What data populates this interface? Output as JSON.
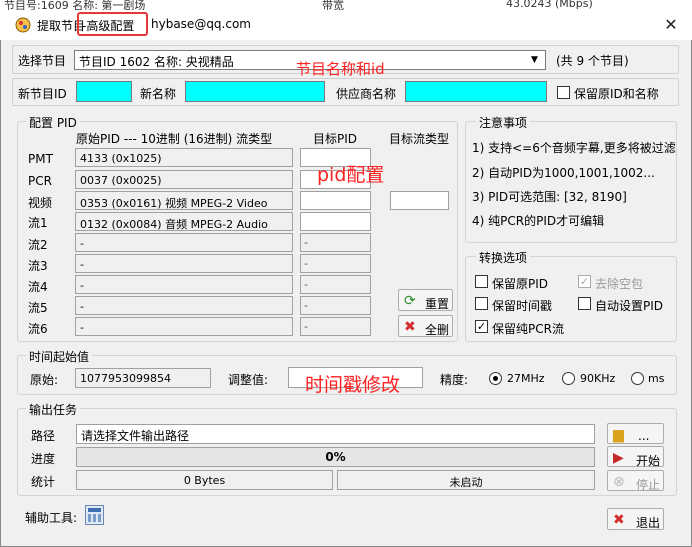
{
  "background_window": {
    "text_left": "节目号:1609  名称: 第一剧场",
    "text_mid": "带宽",
    "text_right": "43.0243  (Mbps)"
  },
  "dialog": {
    "title_prefix": "提取节目",
    "title_highlight": "-高级配置",
    "title_suffix": "hybase@qq.com",
    "close": "✕"
  },
  "program_select": {
    "label": "选择节目",
    "value": "节目ID 1602 名称: 央视精品",
    "count": "(共 9 个节目)",
    "annotation": "节目名称和id"
  },
  "new_program": {
    "id_label": "新节目ID",
    "name_label": "新名称",
    "provider_label": "供应商名称",
    "keep_label": "保留原ID和名称",
    "id_value": "",
    "name_value": "",
    "provider_value": ""
  },
  "pid_config": {
    "title": "配置 PID",
    "col_original": "原始PID --- 10进制 (16进制) 流类型",
    "col_target_pid": "目标PID",
    "col_target_type": "目标流类型",
    "annotation": "pid配置",
    "rows": [
      {
        "label": "PMT",
        "original": "4133 (0x1025)",
        "target": "",
        "editable": true,
        "has_type": false
      },
      {
        "label": "PCR",
        "original": "0037 (0x0025)",
        "target": "",
        "editable": true,
        "has_type": false
      },
      {
        "label": "视频",
        "original": "0353 (0x0161) 视频 MPEG-2 Video",
        "target": "",
        "editable": true,
        "has_type": true
      },
      {
        "label": "流1",
        "original": "0132 (0x0084) 音频 MPEG-2 Audio",
        "target": "",
        "editable": true,
        "has_type": false
      },
      {
        "label": "流2",
        "original": "-",
        "target": "-",
        "editable": false,
        "has_type": false
      },
      {
        "label": "流3",
        "original": "-",
        "target": "-",
        "editable": false,
        "has_type": false
      },
      {
        "label": "流4",
        "original": "-",
        "target": "-",
        "editable": false,
        "has_type": false
      },
      {
        "label": "流5",
        "original": "-",
        "target": "-",
        "editable": false,
        "has_type": false
      },
      {
        "label": "流6",
        "original": "-",
        "target": "-",
        "editable": false,
        "has_type": false
      }
    ],
    "reset": "重置",
    "delete_all": "全删"
  },
  "notes": {
    "title": "注意事项",
    "items": [
      "1) 支持<=6个音频字幕,更多将被过滤",
      "2) 自动PID为1000,1001,1002...",
      "3) PID可选范围: [32, 8190]",
      "4) 纯PCR的PID才可编辑"
    ]
  },
  "convert": {
    "title": "转换选项",
    "keep_original_pid": "保留原PID",
    "remove_null": "去除空包",
    "keep_timestamp": "保留时间戳",
    "auto_pid": "自动设置PID",
    "keep_pure_pcr": "保留纯PCR流"
  },
  "time_start": {
    "title": "时间起始值",
    "original_label": "原始:",
    "original_value": "1077953099854",
    "adjust_label": "调整值:",
    "adjust_value": "",
    "annotation": "时间戳修改",
    "precision_label": "精度:",
    "options": [
      "27MHz",
      "90KHz",
      "ms"
    ]
  },
  "output": {
    "title": "输出任务",
    "path_label": "路径",
    "path_value": "请选择文件输出路径",
    "browse": "...",
    "progress_label": "进度",
    "progress_text": "0%",
    "progress_value": 0,
    "start": "开始",
    "stats_label": "统计",
    "stats_bytes": "0 Bytes",
    "stats_status": "未启动",
    "stop": "停止"
  },
  "footer": {
    "tools_label": "辅助工具:",
    "exit": "退出"
  }
}
